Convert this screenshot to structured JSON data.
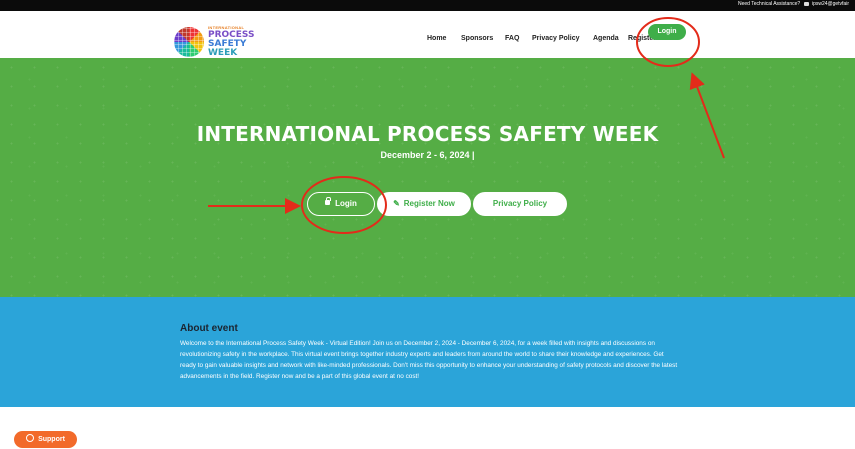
{
  "topbar": {
    "assistance_text": "Need Technical Assistance?",
    "email_text": "ipsw24@getvfair"
  },
  "logo": {
    "small_text": "INTERNATIONAL",
    "line1": "PROCESS",
    "line2": "SAFETY",
    "line3": "WEEK"
  },
  "nav": {
    "items": [
      "Home",
      "Sponsors",
      "FAQ",
      "Privacy Policy",
      "Agenda",
      "Register"
    ],
    "login": "Login"
  },
  "hero": {
    "title": "INTERNATIONAL PROCESS SAFETY WEEK",
    "date": "December 2 - 6, 2024 |",
    "buttons": {
      "login": "Login",
      "register": "Register Now",
      "privacy": "Privacy Policy"
    }
  },
  "about": {
    "title": "About event",
    "text": "Welcome to the International Process Safety Week - Virtual Edition! Join us on December 2, 2024 - December 6, 2024, for a week filled with insights and discussions on revolutionizing safety in the workplace. This virtual event brings together industry experts and leaders from around the world to share their knowledge and experiences. Get ready to gain valuable insights and network with like-minded professionals. Don't miss this opportunity to enhance your understanding of safety protocols and discover the latest advancements in the field. Register now and be a part of this global event at no cost!"
  },
  "support": {
    "label": "Support"
  },
  "colors": {
    "brand_green": "#3fae49",
    "hero_green": "#55ad45",
    "about_blue": "#2ba4d9",
    "support_orange": "#f26a2a",
    "annotation_red": "#e32b1a"
  },
  "icons": {
    "lock": "lock-icon",
    "pencil": "pencil-icon",
    "chat": "chat-icon",
    "mail": "mail-icon"
  }
}
